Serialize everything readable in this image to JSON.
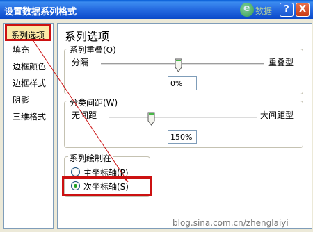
{
  "window": {
    "title": "设置数据系列格式",
    "watermark": "数据",
    "help_label": "?",
    "close_label": "X"
  },
  "sidebar": {
    "items": [
      {
        "label": "系列选项",
        "selected": true
      },
      {
        "label": "填充"
      },
      {
        "label": "边框颜色"
      },
      {
        "label": "边框样式"
      },
      {
        "label": "阴影"
      },
      {
        "label": "三维格式"
      }
    ]
  },
  "main": {
    "title": "系列选项",
    "overlap": {
      "label": "系列重叠(O)",
      "min_label": "分隔",
      "max_label": "重叠型",
      "value": "0%",
      "slider_fraction": 0.5
    },
    "gap": {
      "label": "分类间距(W)",
      "min_label": "无间距",
      "max_label": "大间距型",
      "value": "150%",
      "slider_fraction": 0.3
    },
    "plot_on": {
      "label": "系列绘制在",
      "options": [
        {
          "label": "主坐标轴(P)",
          "checked": false
        },
        {
          "label": "次坐标轴(S)",
          "checked": true
        }
      ]
    }
  },
  "footer_watermark": "blog.sina.com.cn/zhenglaiyi",
  "colors": {
    "highlight": "#cc1111",
    "titlebar": "#2469e0",
    "selected_bg": "#fbe9a8"
  }
}
